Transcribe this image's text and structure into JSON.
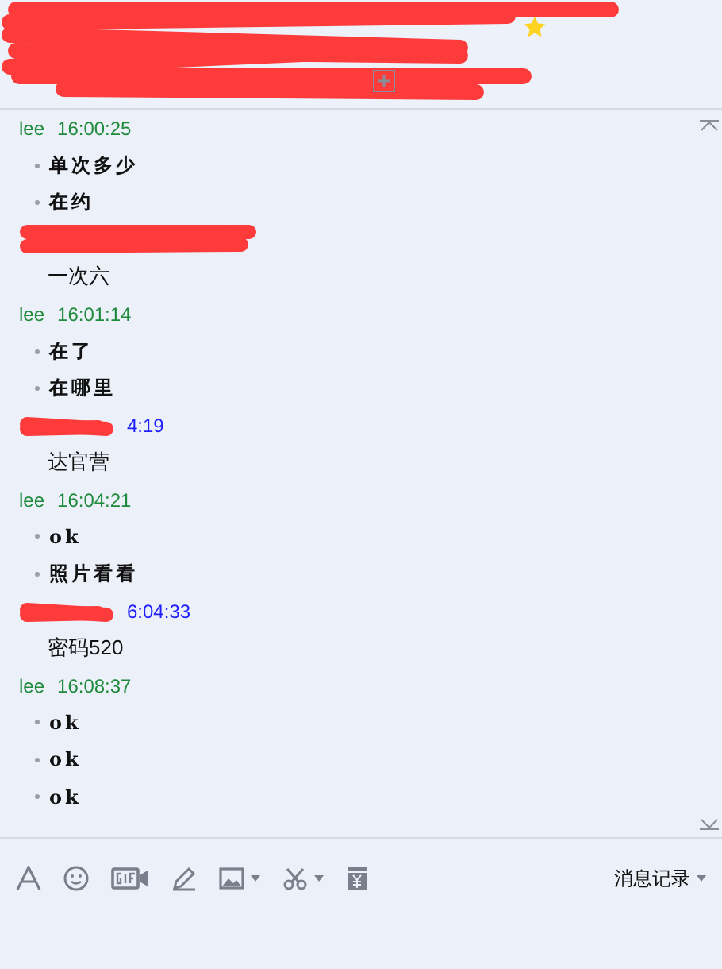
{
  "header": {
    "starred": true,
    "redacted": true
  },
  "messages": [
    {
      "kind": "self",
      "sender": "lee",
      "time": "16:00:25",
      "redacted": false,
      "lines": [
        {
          "kind": "bullet",
          "text": "单次多少"
        },
        {
          "kind": "bullet",
          "text": "在约"
        }
      ]
    },
    {
      "kind": "other",
      "redacted": true,
      "lines": [
        {
          "kind": "plain",
          "text": "一次六"
        }
      ]
    },
    {
      "kind": "self",
      "sender": "lee",
      "time": "16:01:14",
      "redacted": false,
      "lines": [
        {
          "kind": "bullet",
          "text": "在了"
        },
        {
          "kind": "bullet",
          "text": "在哪里"
        }
      ]
    },
    {
      "kind": "other",
      "time": "4:19",
      "redacted": true,
      "lines": [
        {
          "kind": "plain",
          "text": "达官营"
        }
      ]
    },
    {
      "kind": "self",
      "sender": "lee",
      "time": "16:04:21",
      "redacted": false,
      "lines": [
        {
          "kind": "bullet",
          "text": "ok"
        },
        {
          "kind": "bullet",
          "text": "照片看看"
        }
      ]
    },
    {
      "kind": "other",
      "time": "6:04:33",
      "redacted": true,
      "lines": [
        {
          "kind": "plain",
          "text": "密码520"
        }
      ]
    },
    {
      "kind": "self",
      "sender": "lee",
      "time": "16:08:37",
      "redacted": false,
      "lines": [
        {
          "kind": "bullet",
          "text": "ok"
        },
        {
          "kind": "bullet",
          "text": "ok"
        },
        {
          "kind": "bullet",
          "text": "ok"
        }
      ]
    }
  ],
  "composer": {
    "history_button": "消息记录"
  }
}
